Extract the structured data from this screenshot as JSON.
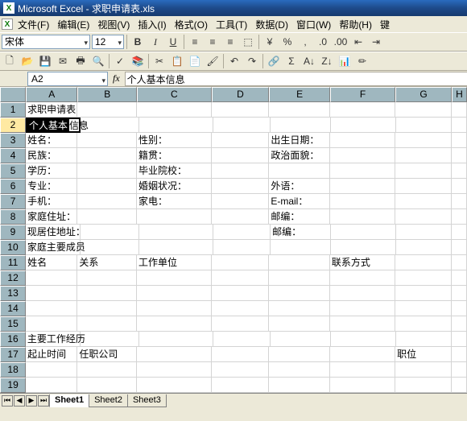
{
  "title": "Microsoft Excel - 求职申请表.xls",
  "menu": [
    "文件(F)",
    "编辑(E)",
    "视图(V)",
    "插入(I)",
    "格式(O)",
    "工具(T)",
    "数据(D)",
    "窗口(W)",
    "帮助(H)",
    "键"
  ],
  "toolbar1": {
    "font": "宋体",
    "size": "12",
    "buttons": [
      "B",
      "I",
      "U"
    ]
  },
  "formulaBar": {
    "name": "A2",
    "fx": "fx",
    "text": "个人基本信息"
  },
  "columns": [
    "A",
    "B",
    "C",
    "D",
    "E",
    "F",
    "G",
    "H"
  ],
  "rows": [
    1,
    2,
    3,
    4,
    5,
    6,
    7,
    8,
    9,
    10,
    11,
    12,
    13,
    14,
    15,
    16,
    17,
    18,
    19
  ],
  "activeRow": 2,
  "cells": {
    "r1": {
      "A": "求职申请表"
    },
    "r2": {
      "A": "个人基本信息"
    },
    "r3": {
      "A": "姓名：",
      "C": "性别：",
      "E": "出生日期："
    },
    "r4": {
      "A": "民族：",
      "C": "籍贯：",
      "E": "政治面貌："
    },
    "r5": {
      "A": "学历：",
      "C": "毕业院校："
    },
    "r6": {
      "A": "专业：",
      "C": "婚姻状况：",
      "E": "外语："
    },
    "r7": {
      "A": "手机：",
      "C": "家电：",
      "E": "E-mail："
    },
    "r8": {
      "A": "家庭住址：",
      "E": "邮编："
    },
    "r9": {
      "A": "现居住地址：",
      "E": "邮编："
    },
    "r10": {
      "A": "家庭主要成员"
    },
    "r11": {
      "A": "姓名",
      "B": "关系",
      "C": "工作单位",
      "F": "联系方式"
    },
    "r16": {
      "A": "主要工作经历"
    },
    "r17": {
      "A": "起止时间",
      "B": "任职公司",
      "G": "职位"
    }
  },
  "tabs": [
    "Sheet1",
    "Sheet2",
    "Sheet3"
  ],
  "activeTab": 0,
  "chart_data": null
}
